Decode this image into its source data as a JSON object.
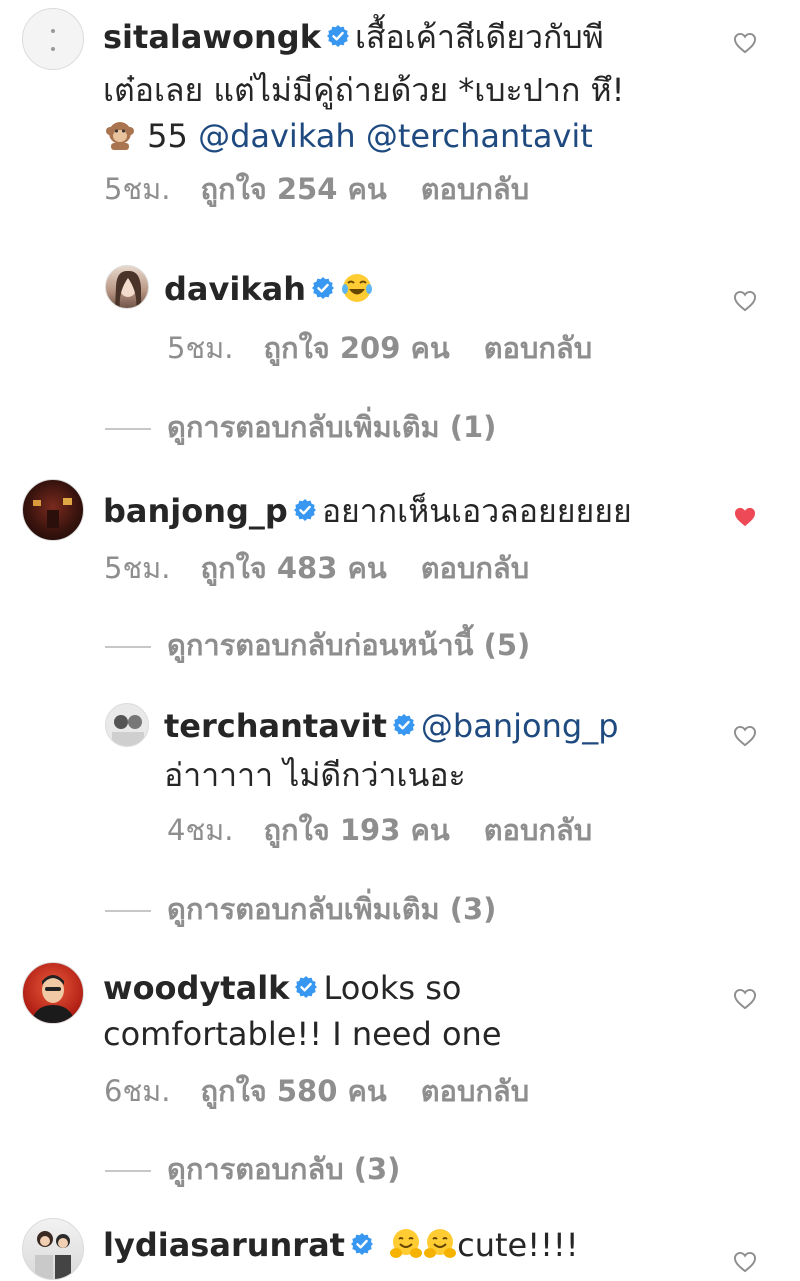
{
  "comments": {
    "c1": {
      "username": "sitalawongk",
      "line1": "เสื้อเค้าสีเดียวกับพี",
      "line2": "เต๋อเลย แต่ไม่มีคู่ถ่ายด้วย *เบะปาก หึ!",
      "line3_prefix": "55",
      "mention_1": "@davikah",
      "mention_2": "@terchantavit",
      "time": "5ชม.",
      "likes": "ถูกใจ 254 คน",
      "reply_label": "ตอบกลับ",
      "liked": false,
      "emoji_icon": "monkey-icon"
    },
    "c1r1": {
      "username": "davikah",
      "time": "5ชม.",
      "likes": "ถูกใจ 209 คน",
      "reply_label": "ตอบกลับ",
      "view_more": "ดูการตอบกลับเพิ่มเติม (1)",
      "emoji_icon": "tears-of-joy-icon"
    },
    "c2": {
      "username": "banjong_p",
      "text": "อยากเห็นเอวลอยยยยย",
      "time": "5ชม.",
      "likes": "ถูกใจ 483 คน",
      "reply_label": "ตอบกลับ",
      "liked": true,
      "view_prev": "ดูการตอบกลับก่อนหน้านี้ (5)"
    },
    "c2r1": {
      "username": "terchantavit",
      "mention": "@banjong_p",
      "line2": "อ่าาาาา ไม่ดีกว่าเนอะ",
      "time": "4ชม.",
      "likes": "ถูกใจ 193 คน",
      "reply_label": "ตอบกลับ",
      "view_more": "ดูการตอบกลับเพิ่มเติม (3)"
    },
    "c3": {
      "username": "woodytalk",
      "line1": "Looks so",
      "line2": "comfortable!! I need one",
      "time": "6ชม.",
      "likes": "ถูกใจ 580 คน",
      "reply_label": "ตอบกลับ",
      "view_more": "ดูการตอบกลับ (3)"
    },
    "c4": {
      "username": "lydiasarunrat",
      "text": "cute!!!!",
      "emoji_icon": "hugging-face-icon"
    }
  },
  "colors": {
    "verified": "#3897f0",
    "heart_liked": "#ed4956",
    "heart_outline": "#8e8e8e",
    "muted": "#8e8e8e",
    "mention": "#1e4a80"
  }
}
